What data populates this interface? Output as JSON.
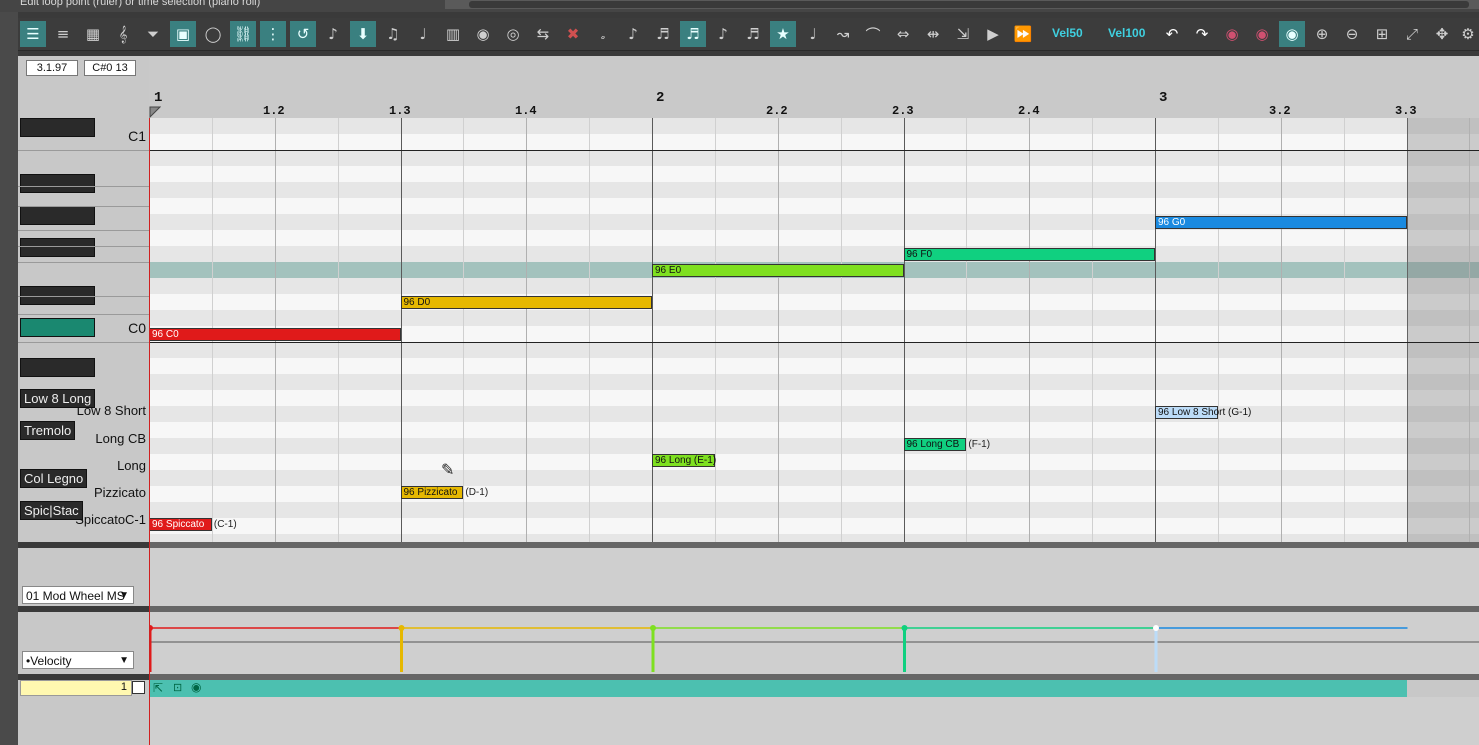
{
  "window": {
    "title": "Edit loop point (ruler) or time selection (piano roll)"
  },
  "toolbar": {
    "icons": [
      "piano-roll-icon",
      "list-icon",
      "grid-icon",
      "treble-clef-icon",
      "filter-icon",
      "note-editor-icon",
      "lasso-icon",
      "link-icon",
      "snap-grid-icon",
      "loop-icon",
      "step-input-icon",
      "midi-input-icon",
      "quantize-icon",
      "note-icon",
      "keyboard-icon",
      "record-icon",
      "overdub-icon",
      "split-icon",
      "delete-icon",
      "note-length-icon",
      "eighth-note-icon",
      "sixteenth-note-icon",
      "triplet-icon",
      "dotted-note-icon",
      "star-icon",
      "thirty-second-note-icon",
      "glissando-icon",
      "curve-icon",
      "stretch-icon",
      "compress-icon",
      "marker-icon",
      "play-icon",
      "fast-forward-icon"
    ],
    "vel50": "Vel50",
    "vel100": "Vel100",
    "right_icons": [
      "undo-icon",
      "redo-icon",
      "hide-cc-icon",
      "show-cc-icon",
      "eye-icon",
      "zoom-in-icon",
      "zoom-out-icon",
      "zoom-h-in-icon",
      "zoom-v-icon",
      "fit-icon",
      "pan-icon",
      "settings-icon"
    ]
  },
  "position": {
    "time": "3.1.97",
    "note": "C#0  13"
  },
  "ruler": {
    "bars": [
      "1",
      "2",
      "3"
    ],
    "minors": [
      "1.2",
      "1.3",
      "1.4",
      "2.2",
      "2.3",
      "2.4",
      "3.2",
      "3.3"
    ]
  },
  "keys": {
    "c1": "C1",
    "c0": "C0"
  },
  "articulations": {
    "low8long": "Low 8 Long",
    "tremolo": "Tremolo",
    "collegno": "Col Legno",
    "spicstac": "Spic|Stac",
    "low8short": "Low 8 Short",
    "longcb": "Long CB",
    "long": "Long",
    "pizzicato": "Pizzicato",
    "spiccato": "SpiccatoC-1"
  },
  "notes": [
    {
      "label": "96 C0",
      "color": "#e01a1a"
    },
    {
      "label": "96 D0",
      "color": "#e6b800"
    },
    {
      "label": "96 E0",
      "color": "#7ee020"
    },
    {
      "label": "96 F0",
      "color": "#10d080"
    },
    {
      "label": "96 G0",
      "color": "#1a8ae0"
    }
  ],
  "art_notes": [
    {
      "label": "96 Spiccato",
      "suffix": "(C-1)",
      "color": "#e01a1a"
    },
    {
      "label": "96 Pizzicato",
      "suffix": "(D-1)",
      "color": "#e6b800"
    },
    {
      "label": "96 Long (E-1)",
      "suffix": "",
      "color": "#7ee020"
    },
    {
      "label": "96 Long CB",
      "suffix": "(F-1)",
      "color": "#10d080"
    },
    {
      "label": "96 Low 8 Short (G-1)",
      "suffix": "",
      "color": "#bcdcf8"
    }
  ],
  "lanes": {
    "cc": "01 Mod Wheel MS",
    "velocity": "•Velocity",
    "track_num": "1"
  }
}
